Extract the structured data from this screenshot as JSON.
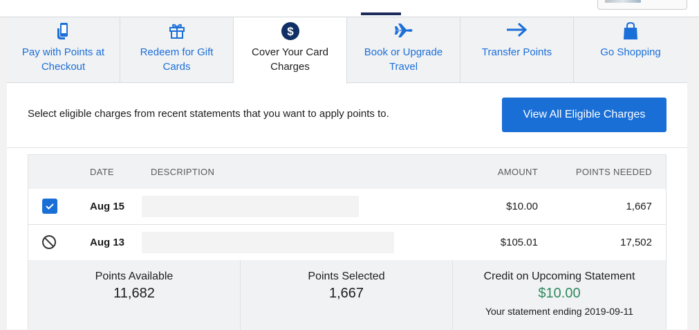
{
  "colors": {
    "link_blue": "#1b6fd8",
    "primary_button": "#1a6fd6",
    "credit_green": "#2e8a5e",
    "active_tab_indicator": "#1c2a5c"
  },
  "tabs": [
    {
      "label": "Pay with Points at Checkout",
      "icon": "tap-phone-icon",
      "active": false
    },
    {
      "label": "Redeem for Gift Cards",
      "icon": "gift-icon",
      "active": false
    },
    {
      "label": "Cover Your Card Charges",
      "icon": "dollar-circle-icon",
      "active": true
    },
    {
      "label": "Book or Upgrade Travel",
      "icon": "airplane-icon",
      "active": false
    },
    {
      "label": "Transfer Points",
      "icon": "arrow-right-icon",
      "active": false
    },
    {
      "label": "Go Shopping",
      "icon": "shopping-bag-icon",
      "active": false
    }
  ],
  "instructions": "Select eligible charges from recent statements that you want to apply points to.",
  "view_all_button": "View All Eligible Charges",
  "table": {
    "headers": {
      "date": "DATE",
      "description": "DESCRIPTION",
      "amount": "AMOUNT",
      "points": "POINTS NEEDED"
    },
    "rows": [
      {
        "status": "checked",
        "date": "Aug 15",
        "amount": "$10.00",
        "points": "1,667"
      },
      {
        "status": "ineligible",
        "date": "Aug 13",
        "amount": "$105.01",
        "points": "17,502"
      }
    ]
  },
  "summary": {
    "available_label": "Points Available",
    "available_value": "11,682",
    "selected_label": "Points Selected",
    "selected_value": "1,667",
    "credit_label": "Credit on Upcoming Statement",
    "credit_value": "$10.00",
    "credit_note": "Your statement ending 2019-09-11"
  }
}
